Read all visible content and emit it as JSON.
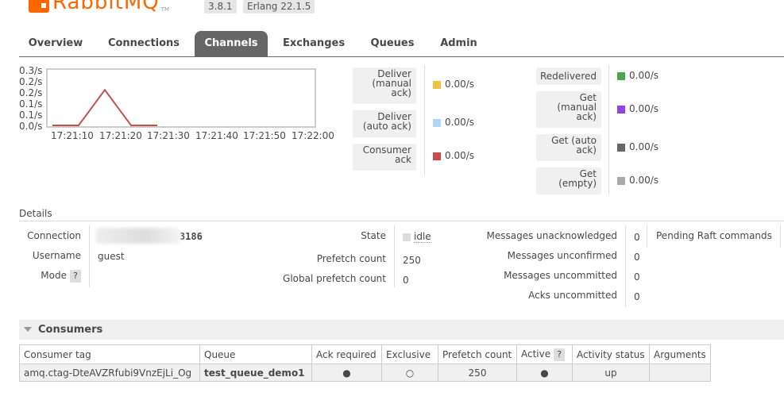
{
  "header": {
    "logo_text": "RabbitMQ",
    "trademark": "TM",
    "version": "3.8.1",
    "erlang": "Erlang 22.1.5"
  },
  "tabs": [
    {
      "label": "Overview",
      "active": false
    },
    {
      "label": "Connections",
      "active": false
    },
    {
      "label": "Channels",
      "active": true
    },
    {
      "label": "Exchanges",
      "active": false
    },
    {
      "label": "Queues",
      "active": false
    },
    {
      "label": "Admin",
      "active": false
    }
  ],
  "chart_data": {
    "type": "line",
    "title": "",
    "xlabel": "",
    "ylabel": "",
    "y_tick_labels": [
      "0.3/s",
      "0.2/s",
      "0.2/s",
      "0.1/s",
      "0.1/s",
      "0.0/s"
    ],
    "x_tick_labels": [
      "17:21:10",
      "17:21:20",
      "17:21:30",
      "17:21:40",
      "17:21:50",
      "17:22:00"
    ],
    "ylim": [
      0,
      0.3
    ],
    "series": [
      {
        "name": "Consumer ack",
        "color": "#c0504d",
        "x": [
          "17:21:10",
          "17:21:15",
          "17:21:20",
          "17:21:25",
          "17:21:30"
        ],
        "y": [
          0,
          0,
          0.2,
          0,
          0
        ]
      }
    ]
  },
  "rates_left": [
    {
      "label": "Deliver (manual ack)",
      "lines": [
        "Deliver",
        "(manual",
        "ack)"
      ],
      "color": "#edc240",
      "value": "0.00/s"
    },
    {
      "label": "Deliver (auto ack)",
      "lines": [
        "Deliver",
        "(auto ack)"
      ],
      "color": "#afd8f8",
      "value": "0.00/s"
    },
    {
      "label": "Consumer ack",
      "lines": [
        "Consumer",
        "ack"
      ],
      "color": "#cb4b4b",
      "value": "0.00/s"
    }
  ],
  "rates_right": [
    {
      "label": "Redelivered",
      "lines": [
        "Redelivered"
      ],
      "color": "#4da74d",
      "value": "0.00/s"
    },
    {
      "label": "Get (manual ack)",
      "lines": [
        "Get",
        "(manual",
        "ack)"
      ],
      "color": "#9440ed",
      "value": "0.00/s"
    },
    {
      "label": "Get (auto ack)",
      "lines": [
        "Get (auto",
        "ack)"
      ],
      "color": "#666666",
      "value": "0.00/s"
    },
    {
      "label": "Get (empty)",
      "lines": [
        "Get",
        "(empty)"
      ],
      "color": "#aaaaaa",
      "value": "0.00/s"
    }
  ],
  "details": {
    "title": "Details",
    "connection_label": "Connection",
    "connection_value": "20.191.24 4:53186",
    "username_label": "Username",
    "username_value": "guest",
    "mode_label": "Mode",
    "mode_help": "?",
    "state_label": "State",
    "state_value": "idle",
    "prefetch_label": "Prefetch count",
    "prefetch_value": "250",
    "global_prefetch_label": "Global prefetch count",
    "global_prefetch_value": "0",
    "msg_unack_label": "Messages unacknowledged",
    "msg_unack_value": "0",
    "msg_unconf_label": "Messages unconfirmed",
    "msg_unconf_value": "0",
    "msg_uncommit_label": "Messages uncommitted",
    "msg_uncommit_value": "0",
    "acks_uncommit_label": "Acks uncommitted",
    "acks_uncommit_value": "0",
    "pending_raft_label": "Pending Raft commands"
  },
  "consumers": {
    "title": "Consumers",
    "columns": [
      "Consumer tag",
      "Queue",
      "Ack required",
      "Exclusive",
      "Prefetch count",
      "Active",
      "Activity status",
      "Arguments"
    ],
    "active_help": "?",
    "row": {
      "tag": "amq.ctag-DteAVZRfubi9VnzEjLi_Og",
      "queue": "test_queue_demo1",
      "ack_required": "●",
      "exclusive": "○",
      "prefetch": "250",
      "active": "●",
      "status": "up",
      "arguments": ""
    }
  }
}
